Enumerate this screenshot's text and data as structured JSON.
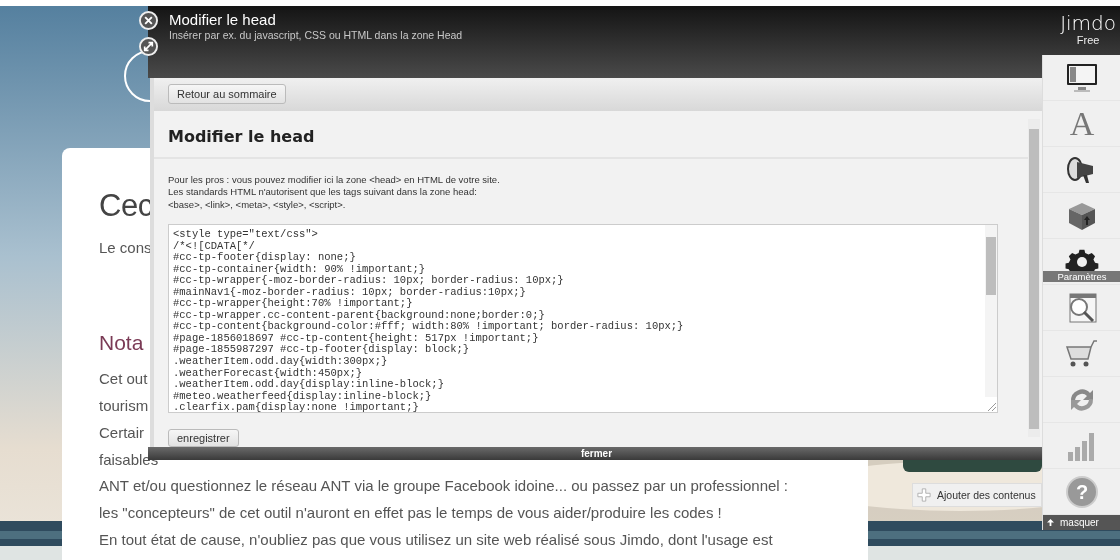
{
  "page": {
    "heading": "Cec",
    "intro": "Le cons",
    "subheading": "Nota",
    "left_lines": [
      "Cet out",
      "tourism",
      "Certair",
      "faisables"
    ],
    "lines": [
      "ANT et/ou questionnez le réseau ANT via le groupe Facebook idoine... ou passez par un professionnel :",
      "les \"concepteurs\" de cet outil n'auront en effet pas le temps de vous aider/produire les codes !",
      "En tout état de cause, n'oubliez pas que vous utilisez un site web réalisé sous Jimdo, dont l'usage est"
    ],
    "add_button": "Ajouter des contenus"
  },
  "dialog": {
    "title": "Modifier le head",
    "subtitle": "Insérer par ex. du javascript, CSS ou HTML dans la zone Head",
    "back_button": "Retour au sommaire",
    "heading": "Modifier le head",
    "description": [
      "Pour les pros : vous pouvez modifier ici la zone <head> en HTML de votre site.",
      "Les standards HTML n'autorisent que les tags suivant dans la zone head:",
      "<base>, <link>, <meta>, <style>, <script>."
    ],
    "code": [
      "<style type=\"text/css\">",
      "/*<![CDATA[*/",
      "#cc-tp-footer{display: none;}",
      "#cc-tp-container{width: 90% !important;}",
      "#cc-tp-wrapper{-moz-border-radius: 10px; border-radius: 10px;}",
      "#mainNav1{-moz-border-radius: 10px; border-radius:10px;}",
      "#cc-tp-wrapper{height:70% !important;}",
      "#cc-tp-wrapper.cc-content-parent{background:none;border:0;}",
      "#cc-tp-content{background-color:#fff; width:80% !important; border-radius: 10px;}",
      "#page-1856018697 #cc-tp-content{height: 517px !important;}",
      "#page-1855987297 #cc-tp-footer{display: block;}",
      ".weatherItem.odd.day{width:300px;}",
      ".weatherForecast{width:450px;}",
      ".weatherItem.odd.day{display:inline-block;}",
      "#meteo.weatherfeed{display:inline-block;}",
      ".clearfix.pam{display:none !important;}"
    ],
    "save_button": "enregistrer",
    "close_bar": "fermer"
  },
  "brand": {
    "name": "Jimdo",
    "plan": "Free"
  },
  "sidebar": {
    "items": [
      {
        "kind": "monitor"
      },
      {
        "kind": "font",
        "glyph": "A"
      },
      {
        "kind": "megaphone"
      },
      {
        "kind": "box"
      },
      {
        "kind": "gear",
        "label": "Paramètres"
      },
      {
        "kind": "inspect"
      },
      {
        "kind": "cart"
      },
      {
        "kind": "sync"
      },
      {
        "kind": "chart"
      },
      {
        "kind": "help",
        "glyph": "?"
      }
    ],
    "hide_button": "masquer"
  }
}
